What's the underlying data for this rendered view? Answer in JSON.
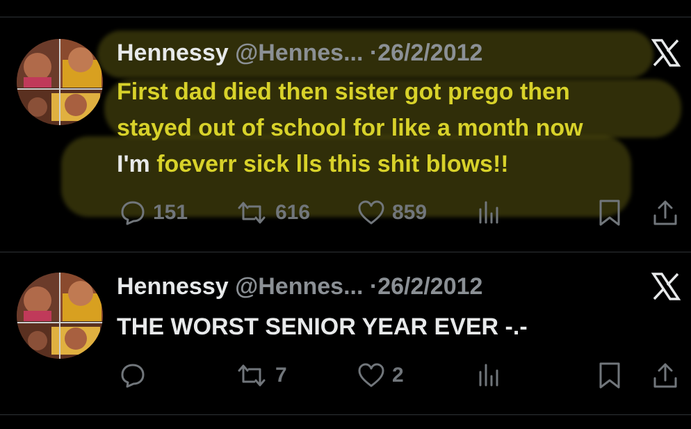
{
  "tweets": [
    {
      "name": "Hennessy",
      "handle": "@Hennes...",
      "separator": "·",
      "date": "26/2/2012",
      "text_lines": [
        "First dad died then sister got prego then",
        "stayed out of school for like a month now",
        "I'm foeverr sick lls this shit blows!!"
      ],
      "replies": "151",
      "retweets": "616",
      "likes": "859",
      "highlighted": true,
      "logo": "x-logo-icon"
    },
    {
      "name": "Hennessy",
      "handle": "@Hennes...",
      "separator": "·",
      "date": "26/2/2012",
      "text_lines": [
        "THE WORST SENIOR YEAR EVER -.-"
      ],
      "replies": "",
      "retweets": "7",
      "likes": "2",
      "highlighted": false,
      "logo": "x-logo-icon"
    }
  ],
  "icons": {
    "reply": "reply-icon",
    "retweet": "retweet-icon",
    "like": "heart-icon",
    "views": "views-icon",
    "bookmark": "bookmark-icon",
    "share": "share-icon"
  },
  "colors": {
    "background": "#000000",
    "text": "#e7e9ea",
    "secondary": "#71767b",
    "highlight_text": "#d8d22a",
    "divider": "#2f3336"
  }
}
